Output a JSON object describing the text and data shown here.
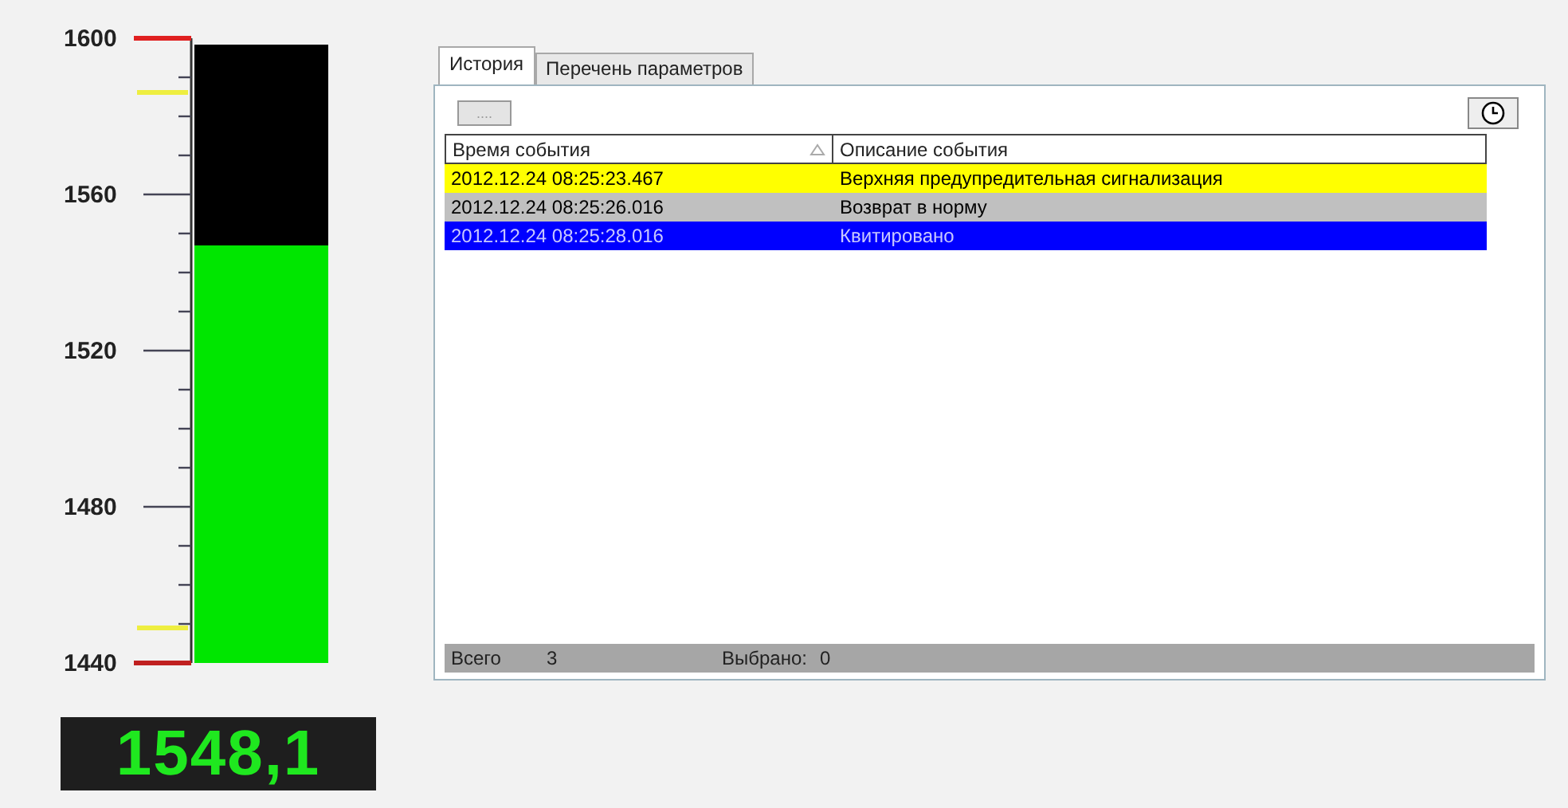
{
  "gauge": {
    "scale": [
      "1600",
      "1560",
      "1520",
      "1480",
      "1440"
    ],
    "level": 0.676,
    "reading": "1548,1"
  },
  "tabs": [
    {
      "label": "История",
      "selected": true
    },
    {
      "label": "Перечень параметров",
      "selected": false
    }
  ],
  "toolbar": {
    "button": "...."
  },
  "table": {
    "columns": [
      {
        "label": "Время события",
        "sorted": true
      },
      {
        "label": "Описание события",
        "sorted": false
      }
    ],
    "rows": [
      {
        "cells": [
          "2012.12.24  08:25:23.467",
          "Верхняя предупредительная сигнализация"
        ],
        "color": "#ffff00"
      },
      {
        "cells": [
          "2012.12.24  08:25:26.016",
          "Возврат в норму"
        ],
        "color": "#c0c0c0"
      },
      {
        "cells": [
          "2012.12.24  08:25:28.016",
          "Квитировано"
        ],
        "color": "#0000ff"
      }
    ]
  },
  "status_bar": {
    "total_label": "Всего",
    "total": "3",
    "selected_label": "Выбрано:",
    "selected": "0"
  }
}
